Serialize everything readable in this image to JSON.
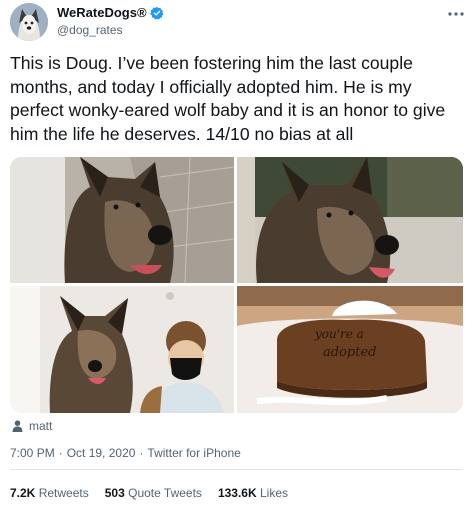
{
  "account": {
    "name": "WeRateDogs®",
    "handle": "@dog_rates",
    "verified_color": "#1d9bf0"
  },
  "more_icon": "more-dots-icon",
  "tweet": {
    "text": "This is Doug. I’ve been fostering him the last couple months, and today I officially adopted him. He is my perfect wonky-eared wolf baby and it is an honor to give him the life he deserves. 14/10 no bias at all"
  },
  "media": {
    "cake_text": [
      "you're a",
      "adopted"
    ]
  },
  "attribution": {
    "icon": "person-icon",
    "label": "matt"
  },
  "meta": {
    "time": "7:00 PM",
    "date": "Oct 19, 2020",
    "source": "Twitter for iPhone",
    "separator": "·"
  },
  "stats": {
    "retweets_count": "7.2K",
    "retweets_label": "Retweets",
    "quotes_count": "503",
    "quotes_label": "Quote Tweets",
    "likes_count": "133.6K",
    "likes_label": "Likes"
  }
}
